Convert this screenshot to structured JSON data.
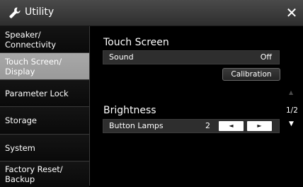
{
  "header": {
    "title": "Utility",
    "icon": "wrench-icon",
    "close_label": "✕"
  },
  "sidebar": {
    "items": [
      {
        "label": "Speaker/\nConnectivity",
        "active": false
      },
      {
        "label": "Touch Screen/\nDisplay",
        "active": true
      },
      {
        "label": "Parameter Lock",
        "active": false
      },
      {
        "label": "Storage",
        "active": false
      },
      {
        "label": "System",
        "active": false
      },
      {
        "label": "Factory Reset/\nBackup",
        "active": false
      }
    ]
  },
  "main": {
    "touch_screen": {
      "title": "Touch Screen",
      "sound_label": "Sound",
      "sound_value": "Off",
      "calibration_label": "Calibration"
    },
    "brightness": {
      "title": "Brightness",
      "button_lamps_label": "Button Lamps",
      "button_lamps_value": "2",
      "decrease_label": "◄",
      "increase_label": "►"
    },
    "pager": {
      "up": "▲",
      "page": "1/2",
      "down": "▼"
    }
  },
  "colors": {
    "active_tab": "#a0a0a0",
    "row_background": "#2e2e2e",
    "titlebar": "#3a3a3a"
  }
}
